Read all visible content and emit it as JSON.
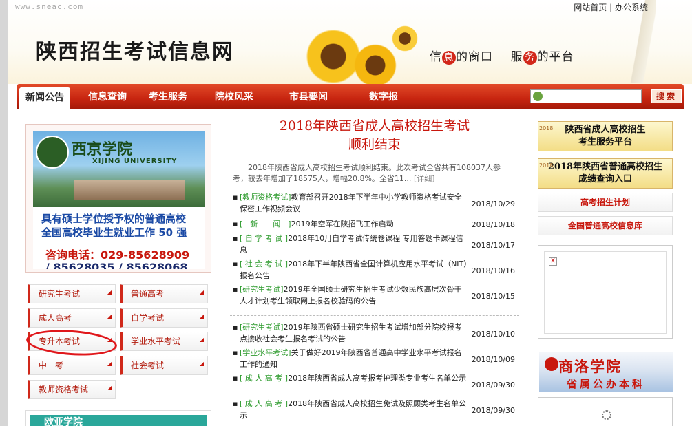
{
  "header": {
    "domain": "www.sneac.com",
    "site_title": "陕西招生考试信息网",
    "top_links": [
      "网站首页",
      "办公系统"
    ],
    "slogan": {
      "part1": "信",
      "hl1": "息",
      "part2": "的窗口",
      "part3": "服",
      "hl2": "务",
      "part4": "的平台"
    }
  },
  "nav": {
    "items": [
      "新闻公告",
      "信息查询",
      "考生服务",
      "院校风采",
      "市县要闻",
      "数字报"
    ],
    "active_index": 0,
    "search_placeholder": "",
    "search_label": "搜索"
  },
  "left": {
    "ad": {
      "school_cn": "西京学院",
      "school_en": "XIJING UNIVERSITY",
      "line1": "具有硕士学位授予权的普通高校",
      "line2": "全国高校毕业生就业工作 50 强",
      "phone1": "咨询电话：029-85628909",
      "phone2": "/ 85628035 / 85628068"
    },
    "buttons": [
      "研究生考试",
      "普通高考",
      "成人高考",
      "自学考试",
      "专升本考试",
      "学业水平考试",
      "中　考",
      "社会考试",
      "教师资格考试"
    ],
    "bottom_banner": "欧亚学院"
  },
  "center": {
    "headline1": "2018年陕西省成人高校招生考试",
    "headline2": "顺利结束",
    "summary": "2018年陕西省成人高校招生考试顺利结束。此次考试全省共有108037人参考，较去年增加了18575人，增幅20.8%。全省11...",
    "more": "[详细]",
    "news": [
      {
        "cat": "[教师资格考试]",
        "title": "教育部召开2018年下半年中小学教师资格考试安全保密工作视频会议",
        "date": "2018/10/29"
      },
      {
        "cat": "[　新　　闻　]",
        "title": "2019年空军在陕招飞工作启动",
        "date": "2018/10/18"
      },
      {
        "cat": "[ 自 学 考 试 ]",
        "title": "2018年10月自学考试传统卷课程 专用答题卡课程信息",
        "date": "2018/10/17"
      },
      {
        "cat": "[ 社 会 考 试 ]",
        "title": "2018年下半年陕西省全国计算机应用水平考试（NIT）报名公告",
        "date": "2018/10/16"
      },
      {
        "cat": "[研究生考试]",
        "title": "2019年全国硕士研究生招生考试少数民族高层次骨干人才计划考生领取网上报名校验码的公告",
        "date": "2018/10/15"
      },
      {
        "cat": "[研究生考试]",
        "title": "2019年陕西省硕士研究生招生考试增加部分院校报考点接收社会考生报名考试的公告",
        "date": "2018/10/10"
      },
      {
        "cat": "[学业水平考试]",
        "title": "关于做好2019年陕西省普通高中学业水平考试报名工作的通知",
        "date": "2018/10/09"
      },
      {
        "cat": "[ 成 人 高 考 ]",
        "title": "2018年陕西省成人高考报考护理类专业考生名单公示",
        "date": "2018/09/30"
      },
      {
        "cat": "[ 成 人 高 考 ]",
        "title": "2018年陕西省成人高校招生免试及照顾类考生名单公示",
        "date": "2018/09/30"
      }
    ]
  },
  "right": {
    "banner1": {
      "year": "2018",
      "line1": "陕西省成人高校招生",
      "line2": "考生服务平台"
    },
    "banner2": {
      "year": "2018",
      "line1": "2018年陕西省普通高校招生",
      "line2": "成绩查询入口"
    },
    "links": [
      "高考招生计划",
      "全国普通高校信息库"
    ],
    "ad": {
      "name": "商洛学院",
      "sub": "省属公办本科"
    }
  }
}
